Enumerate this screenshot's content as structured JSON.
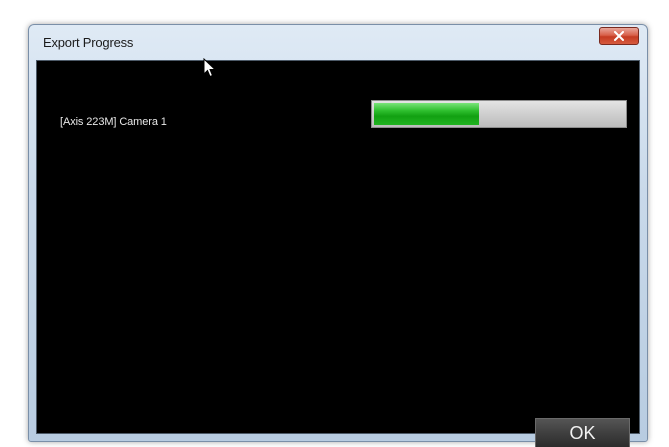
{
  "window": {
    "title": "Export Progress",
    "close_icon": "close-x-icon"
  },
  "export": {
    "camera_label": "[Axis 223M] Camera 1",
    "progress_percent": 42
  },
  "buttons": {
    "ok_label": "OK"
  },
  "colors": {
    "content_background": "#000000",
    "progress_fill": "#22b022",
    "close_button": "#d0503a"
  }
}
